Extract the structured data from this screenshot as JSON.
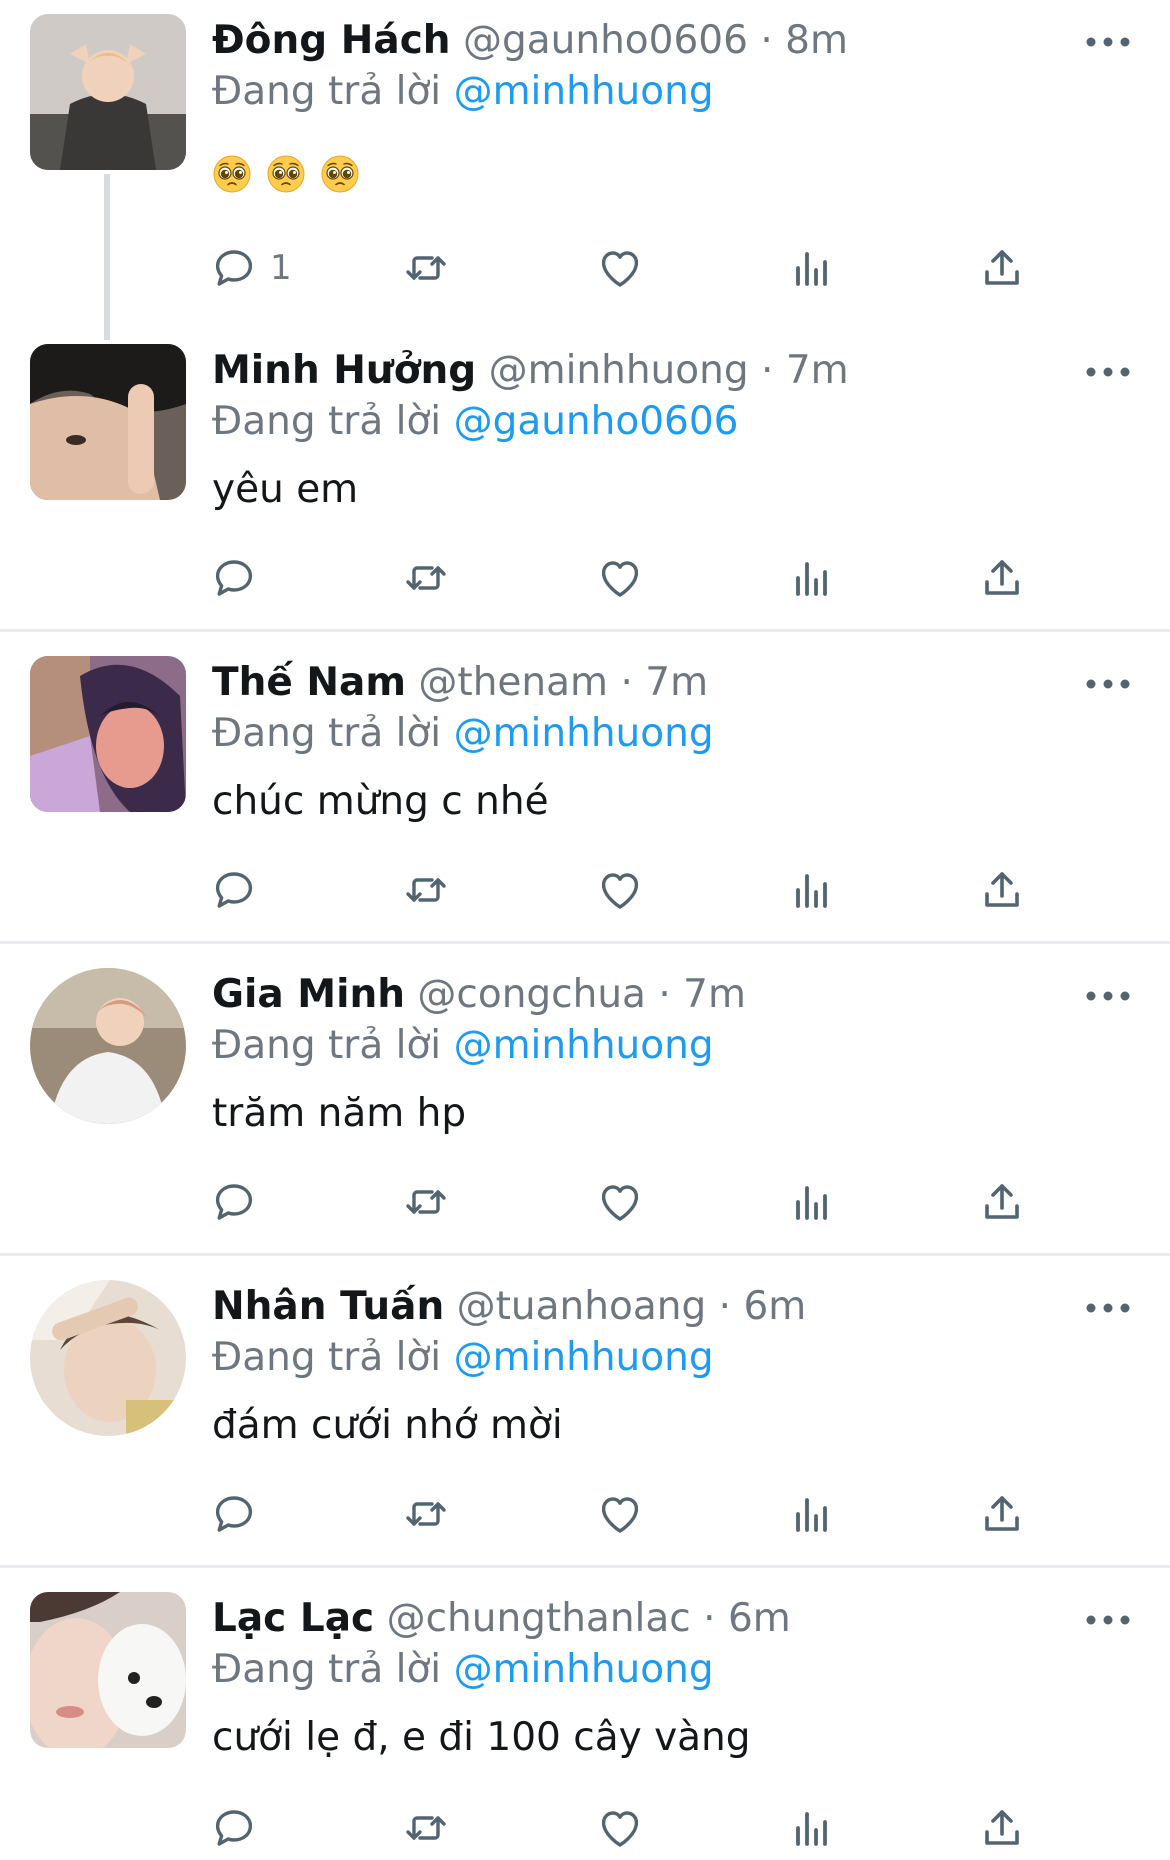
{
  "reply_prefix": "Đang trả lời",
  "tweets": [
    {
      "name": "Đông Hách",
      "handle": "@gaunho0606",
      "sep": "·",
      "time": "8m",
      "reply_to": "@minhhuong",
      "text": "",
      "emoji": [
        "pleading-face",
        "pleading-face",
        "pleading-face"
      ],
      "reply_count": "1"
    },
    {
      "name": "Minh Hưởng",
      "handle": "@minhhuong",
      "sep": "·",
      "time": "7m",
      "reply_to": "@gaunho0606",
      "text": "yêu em",
      "reply_count": ""
    },
    {
      "name": "Thế Nam",
      "handle": "@thenam",
      "sep": "·",
      "time": "7m",
      "reply_to": "@minhhuong",
      "text": "chúc mừng c nhé",
      "reply_count": ""
    },
    {
      "name": "Gia Minh",
      "handle": "@congchua",
      "sep": "·",
      "time": "7m",
      "reply_to": "@minhhuong",
      "text": "trăm năm hp",
      "reply_count": ""
    },
    {
      "name": "Nhân Tuấn",
      "handle": "@tuanhoang",
      "sep": "·",
      "time": "6m",
      "reply_to": "@minhhuong",
      "text": "đám cưới nhớ mời",
      "reply_count": ""
    },
    {
      "name": "Lạc Lạc",
      "handle": "@chungthanlac",
      "sep": "·",
      "time": "6m",
      "reply_to": "@minhhuong",
      "text": "cưới lẹ đ, e đi 100 cây vàng",
      "reply_count": ""
    }
  ],
  "colors": {
    "mention": "#1d9bf0",
    "secondary_text": "#6e7780",
    "icon": "#536471",
    "divider": "#e6ecf0"
  },
  "icons": [
    "more-icon",
    "reply-icon",
    "retweet-icon",
    "like-icon",
    "analytics-icon",
    "share-icon"
  ]
}
